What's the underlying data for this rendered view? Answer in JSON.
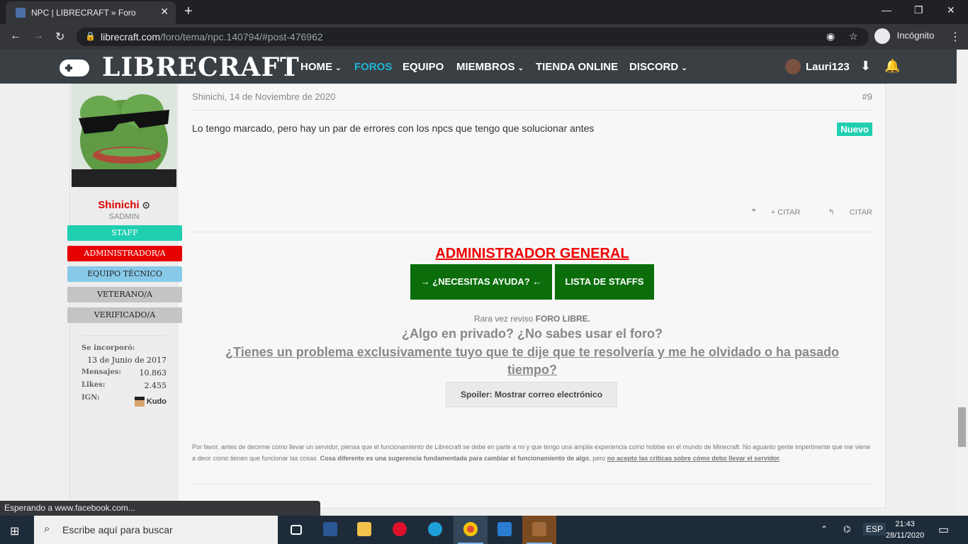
{
  "browser": {
    "tab_title": "NPC | LIBRECRAFT » Foro",
    "url_host": "librecraft.com",
    "url_path": "/foro/tema/npc.140794/#post-476962",
    "incognito_label": "Incógnito",
    "status_text": "Esperando a www.facebook.com..."
  },
  "site": {
    "logo": "LIBRECRAFT",
    "nav": [
      {
        "label": "HOME"
      },
      {
        "label": "FOROS"
      },
      {
        "label": "EQUIPO"
      },
      {
        "label": "MIEMBROS"
      },
      {
        "label": "TIENDA ONLINE"
      },
      {
        "label": "DISCORD"
      }
    ],
    "user": "Lauri123",
    "accent_color": "#1fb6d6"
  },
  "post": {
    "author": "Shinichi",
    "author_title": "SADMIN",
    "badges": [
      {
        "label": "STAFF",
        "color": "#1fcfb0"
      },
      {
        "label": "ADMINISTRADOR/A",
        "color": "#e60000"
      },
      {
        "label": "EQUIPO TÉCNICO",
        "color": "#87c9e8"
      },
      {
        "label": "VETERANO/A",
        "color": "#c4c4c4"
      },
      {
        "label": "VERIFICADO/A",
        "color": "#c4c4c4"
      }
    ],
    "stats": {
      "joined_label": "Se incorporó:",
      "joined_value": "13 de Junio de 2017",
      "messages_label": "Mensajes:",
      "messages_value": "10.863",
      "likes_label": "Likes:",
      "likes_value": "2.455",
      "ign_label": "IGN:",
      "ign_value": "Kudo"
    },
    "meta": "Shinichi, 14 de Noviembre de 2020",
    "number": "#9",
    "message": "Lo tengo marcado, pero hay un par de errores con los npcs que tengo que solucionar antes",
    "new_badge": "Nuevo",
    "quote_multi": "+ CITAR",
    "quote": "CITAR"
  },
  "signature": {
    "title": "ADMINISTRADOR GENERAL",
    "help_button": "→ ¿NECESITAS AYUDA? ←",
    "staff_button": "LISTA DE STAFFS",
    "rarely_prefix": "Rara vez reviso ",
    "rarely_bold": "FORO LIBRE.",
    "question1": "¿Algo en privado? ¿No sabes usar el foro?",
    "question2": "¿Tienes un problema exclusivamente tuyo que te dije que te resolvería y me he olvidado o ha pasado tiempo?",
    "spoiler": "Spoiler: Mostrar correo electrónico",
    "disclaimer_1": "Por favor, antes de decirme como llevar un servidor, piensa que el funcionamiento de Librecraft se debe en parte a mi y que tengo una amplia experiencia como hobbie en el mundo de Minecraft. No aguanto gente impertinente que me viene a decir como tienen que funcionar las cosas. ",
    "disclaimer_bold": "Cosa diferente es una sugerencia fundamentada para cambiar el funcionamiento de algo",
    "disclaimer_2": ", pero ",
    "disclaimer_underline": "no acepto las críticas sobre cómo debo llevar el servidor",
    "disclaimer_end": "."
  },
  "taskbar": {
    "search_placeholder": "Escribe aquí para buscar",
    "lang": "ESP",
    "time": "21:43",
    "date": "28/11/2020"
  }
}
